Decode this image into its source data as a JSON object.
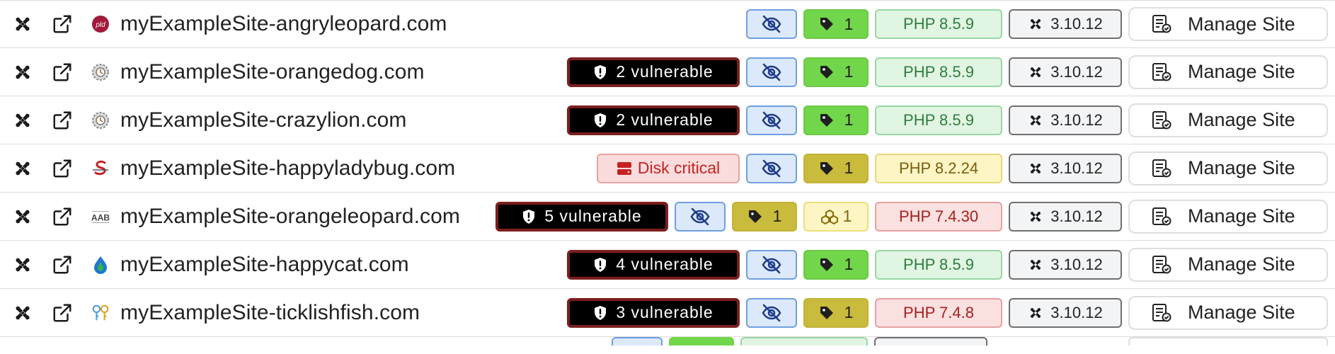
{
  "manage_label": "Manage Site",
  "rows": [
    {
      "name": "myExampleSite-angryleopard.com",
      "favicon": "pld-red-circle-icon",
      "vuln": null,
      "disk": null,
      "tag": "1",
      "tag_color": "green",
      "pkg": null,
      "php": "PHP 8.5.9",
      "php_status": "ok",
      "joomla": "3.10.12"
    },
    {
      "name": "myExampleSite-orangedog.com",
      "favicon": "gear-badge-icon",
      "vuln": "2 vulnerable",
      "disk": null,
      "tag": "1",
      "tag_color": "green",
      "pkg": null,
      "php": "PHP 8.5.9",
      "php_status": "ok",
      "joomla": "3.10.12"
    },
    {
      "name": "myExampleSite-crazylion.com",
      "favicon": "gear-badge-icon",
      "vuln": "2 vulnerable",
      "disk": null,
      "tag": "1",
      "tag_color": "green",
      "pkg": null,
      "php": "PHP 8.5.9",
      "php_status": "ok",
      "joomla": "3.10.12"
    },
    {
      "name": "myExampleSite-happyladybug.com",
      "favicon": "red-s-logo-icon",
      "vuln": null,
      "disk": "Disk critical",
      "tag": "1",
      "tag_color": "olive",
      "pkg": null,
      "php": "PHP 8.2.24",
      "php_status": "warn",
      "joomla": "3.10.12"
    },
    {
      "name": "myExampleSite-orangeleopard.com",
      "favicon": "aab-logo-icon",
      "vuln": "5 vulnerable",
      "disk": null,
      "tag": "1",
      "tag_color": "olive",
      "pkg": "1",
      "php": "PHP 7.4.30",
      "php_status": "bad",
      "joomla": "3.10.12"
    },
    {
      "name": "myExampleSite-happycat.com",
      "favicon": "water-drop-icon",
      "vuln": "4 vulnerable",
      "disk": null,
      "tag": "1",
      "tag_color": "green",
      "pkg": null,
      "php": "PHP 8.5.9",
      "php_status": "ok",
      "joomla": "3.10.12"
    },
    {
      "name": "myExampleSite-ticklishfish.com",
      "favicon": "keys-icon",
      "vuln": "3 vulnerable",
      "disk": null,
      "tag": "1",
      "tag_color": "olive",
      "pkg": null,
      "php": "PHP 7.4.8",
      "php_status": "bad",
      "joomla": "3.10.12"
    }
  ],
  "colors": {
    "vuln_bg": "#000000",
    "vuln_border": "#7c1f1f",
    "tag_green": "#72d64b",
    "tag_olive": "#c9bb3c",
    "php_ok": "#e1f5e3",
    "php_warn": "#fdf6c4",
    "php_bad": "#fbe0e0",
    "eye_bg": "#dce9fb"
  }
}
